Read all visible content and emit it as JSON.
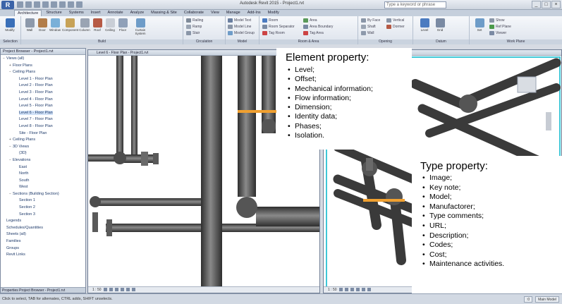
{
  "app": {
    "title": "Autodesk Revit 2015 - Project1.rvt",
    "search_placeholder": "Type a keyword or phrase",
    "window_buttons": [
      "_",
      "□",
      "×"
    ]
  },
  "ribbon": {
    "tabs": [
      "Architecture",
      "Structure",
      "Systems",
      "Insert",
      "Annotate",
      "Analyze",
      "Massing & Site",
      "Collaborate",
      "View",
      "Manage",
      "Add-Ins",
      "Modify"
    ],
    "active_tab": "Architecture",
    "panels": [
      {
        "label": "Selection",
        "buttons": [
          "Modify"
        ]
      },
      {
        "label": "Build",
        "buttons": [
          "Wall",
          "Door",
          "Window",
          "Component",
          "Column",
          "Roof",
          "Ceiling",
          "Floor",
          "Curtain System"
        ]
      },
      {
        "label": "Circulation",
        "buttons": [
          "Railing",
          "Ramp",
          "Stair"
        ]
      },
      {
        "label": "Model",
        "buttons": [
          "Model Text",
          "Model Line",
          "Model Group"
        ]
      },
      {
        "label": "Room & Area",
        "buttons": [
          "Room",
          "Room Separator",
          "Tag Room",
          "Area",
          "Area Boundary",
          "Tag Area"
        ]
      },
      {
        "label": "Opening",
        "buttons": [
          "By Face",
          "Shaft",
          "Wall",
          "Vertical",
          "Dormer"
        ]
      },
      {
        "label": "Datum",
        "buttons": [
          "Level",
          "Grid"
        ]
      },
      {
        "label": "Work Plane",
        "buttons": [
          "Set",
          "Show",
          "Ref Plane",
          "Viewer"
        ]
      }
    ]
  },
  "browser": {
    "title": "Project Browser - Project1.rvt",
    "tree": [
      {
        "label": "Views (all)",
        "level": 0,
        "expanded": true
      },
      {
        "label": "Floor Plans",
        "level": 1,
        "expanded": false
      },
      {
        "label": "Ceiling Plans",
        "level": 1,
        "expanded": true
      },
      {
        "label": "Level 1 - Floor Plan",
        "level": 2
      },
      {
        "label": "Level 2 - Floor Plan",
        "level": 2
      },
      {
        "label": "Level 3 - Floor Plan",
        "level": 2
      },
      {
        "label": "Level 4 - Floor Plan",
        "level": 2
      },
      {
        "label": "Level 5 - Floor Plan",
        "level": 2
      },
      {
        "label": "Level 6 - Floor Plan",
        "level": 2,
        "selected": true
      },
      {
        "label": "Level 7 - Floor Plan",
        "level": 2
      },
      {
        "label": "Level 8 - Floor Plan",
        "level": 2
      },
      {
        "label": "Site - Floor Plan",
        "level": 2
      },
      {
        "label": "Ceiling Plans",
        "level": 1,
        "expanded": false
      },
      {
        "label": "3D Views",
        "level": 1,
        "expanded": true
      },
      {
        "label": "{3D}",
        "level": 2
      },
      {
        "label": "Elevations",
        "level": 1,
        "expanded": true
      },
      {
        "label": "East",
        "level": 2
      },
      {
        "label": "North",
        "level": 2
      },
      {
        "label": "South",
        "level": 2
      },
      {
        "label": "West",
        "level": 2
      },
      {
        "label": "Sections (Building Section)",
        "level": 1,
        "expanded": true
      },
      {
        "label": "Section 1",
        "level": 2
      },
      {
        "label": "Section 2",
        "level": 2
      },
      {
        "label": "Section 3",
        "level": 2
      },
      {
        "label": "Legends",
        "level": 0
      },
      {
        "label": "Schedules/Quantities",
        "level": 0
      },
      {
        "label": "Sheets (all)",
        "level": 0
      },
      {
        "label": "Families",
        "level": 0
      },
      {
        "label": "Groups",
        "level": 0
      },
      {
        "label": "Revit Links",
        "level": 0
      }
    ],
    "footer": "Properties  Project Browser - Project1.rvt"
  },
  "views": {
    "left": {
      "title": "Level 6 - Floor Plan - Project1.rvt",
      "scale": "1 : 50"
    },
    "right": {
      "title": "{3D} - Project1.rvt",
      "scale": "1 : 50"
    }
  },
  "status": {
    "text": "Click to select, TAB for alternates, CTRL adds, SHIFT unselects.",
    "right_items": [
      ":0",
      "Main Model"
    ]
  },
  "callouts": {
    "element": {
      "title": "Element property:",
      "items": [
        "Level;",
        "Offset;",
        "Mechanical information;",
        "Flow information;",
        "Dimension;",
        "Identity data;",
        "Phases;",
        "Isolation."
      ]
    },
    "type": {
      "title": "Type property:",
      "items": [
        "Image;",
        "Key note;",
        "Model;",
        "Manufactorer;",
        "Type comments;",
        "URL;",
        "Description;",
        "Codes;",
        "Cost;",
        "Maintenance activities."
      ]
    }
  },
  "colors": {
    "pipe": "#4a4a4a",
    "pipe_highlight": "#9a9a9a",
    "selection": "#f0a030",
    "ribbon": "#dde3ec",
    "tree_text": "#1f3b6b"
  }
}
